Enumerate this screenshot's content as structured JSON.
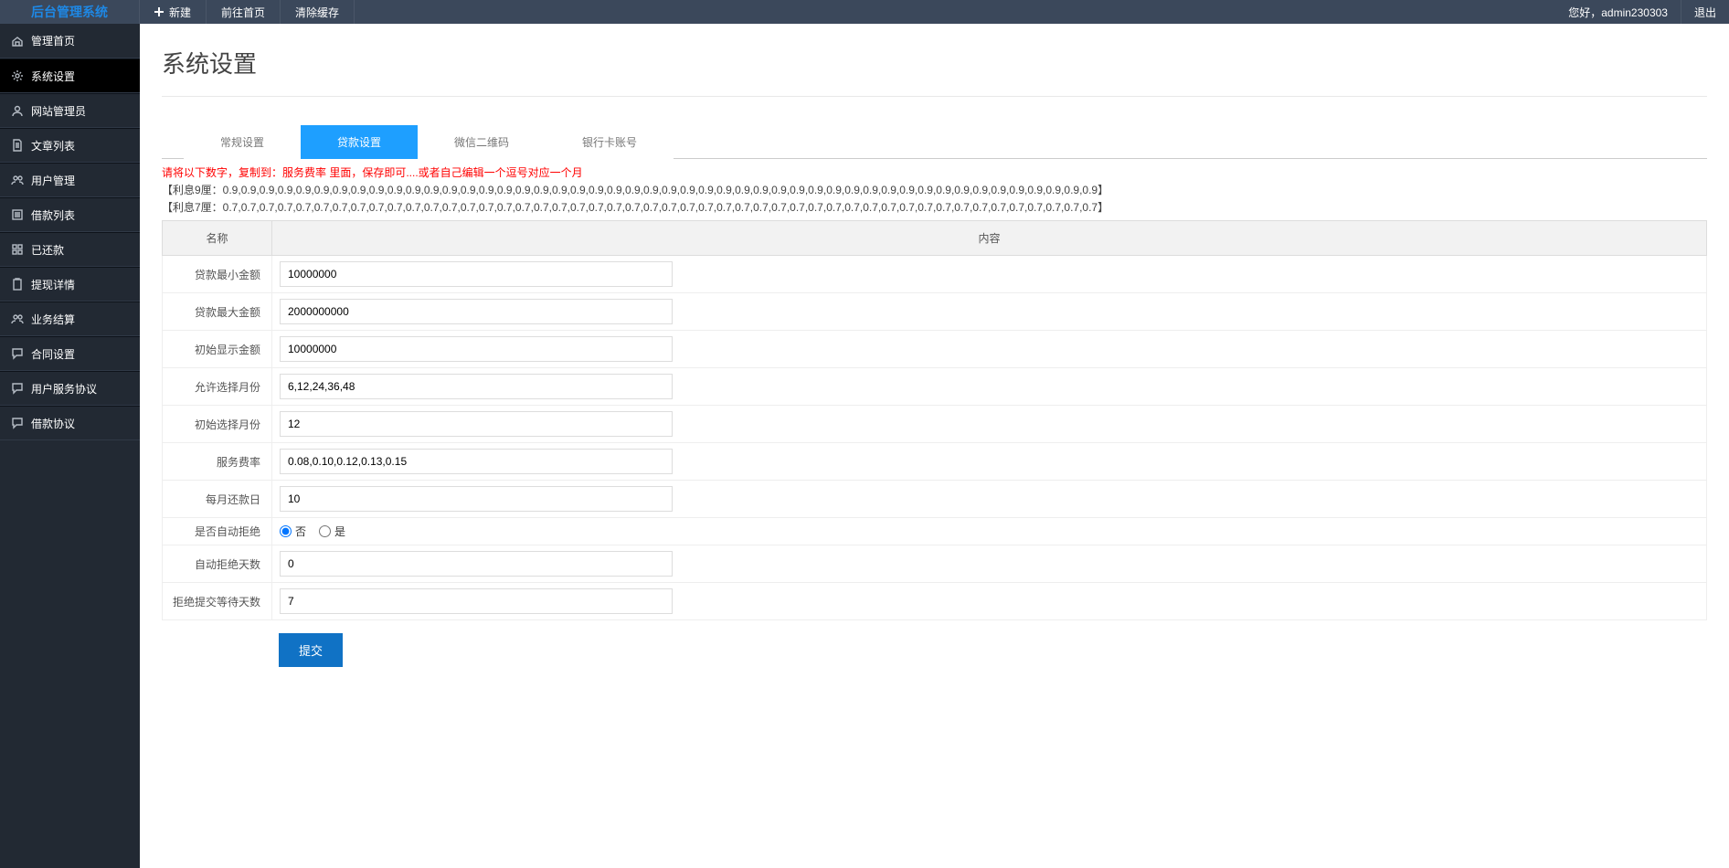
{
  "brand": "后台管理系统",
  "top": {
    "new": "新建",
    "home": "前往首页",
    "clear": "清除缓存",
    "welcome": "您好，admin230303",
    "logout": "退出"
  },
  "sidebar": [
    {
      "key": "dashboard",
      "label": "管理首页",
      "icon": "home"
    },
    {
      "key": "settings",
      "label": "系统设置",
      "icon": "gear",
      "active": true
    },
    {
      "key": "manager",
      "label": "网站管理员",
      "icon": "user"
    },
    {
      "key": "articles",
      "label": "文章列表",
      "icon": "doc"
    },
    {
      "key": "users",
      "label": "用户管理",
      "icon": "users"
    },
    {
      "key": "loans",
      "label": "借款列表",
      "icon": "list"
    },
    {
      "key": "repaid",
      "label": "已还款",
      "icon": "grid"
    },
    {
      "key": "withdraw",
      "label": "提现详情",
      "icon": "clip"
    },
    {
      "key": "biz",
      "label": "业务结算",
      "icon": "users"
    },
    {
      "key": "contract",
      "label": "合同设置",
      "icon": "chat"
    },
    {
      "key": "user-agree",
      "label": "用户服务协议",
      "icon": "chat"
    },
    {
      "key": "loan-agree",
      "label": "借款协议",
      "icon": "chat"
    }
  ],
  "page": {
    "title": "系统设置"
  },
  "tabs": [
    {
      "key": "general",
      "label": "常规设置"
    },
    {
      "key": "loan",
      "label": "贷款设置",
      "active": true
    },
    {
      "key": "wechat",
      "label": "微信二维码"
    },
    {
      "key": "bank",
      "label": "银行卡账号"
    }
  ],
  "warn_text": "请将以下数字，复制到：服务费率 里面，保存即可....或者自己编辑一个逗号对应一个月",
  "data_line1": "【利息9厘：0.9,0.9,0.9,0.9,0.9,0.9,0.9,0.9,0.9,0.9,0.9,0.9,0.9,0.9,0.9,0.9,0.9,0.9,0.9,0.9,0.9,0.9,0.9,0.9,0.9,0.9,0.9,0.9,0.9,0.9,0.9,0.9,0.9,0.9,0.9,0.9,0.9,0.9,0.9,0.9,0.9,0.9,0.9,0.9,0.9,0.9,0.9,0.9】",
  "data_line2": "【利息7厘：0.7,0.7,0.7,0.7,0.7,0.7,0.7,0.7,0.7,0.7,0.7,0.7,0.7,0.7,0.7,0.7,0.7,0.7,0.7,0.7,0.7,0.7,0.7,0.7,0.7,0.7,0.7,0.7,0.7,0.7,0.7,0.7,0.7,0.7,0.7,0.7,0.7,0.7,0.7,0.7,0.7,0.7,0.7,0.7,0.7,0.7,0.7,0.7】",
  "table": {
    "name_header": "名称",
    "content_header": "内容"
  },
  "fields": {
    "min_amount": {
      "label": "贷款最小金额",
      "value": "10000000"
    },
    "max_amount": {
      "label": "贷款最大金额",
      "value": "2000000000"
    },
    "init_amount": {
      "label": "初始显示金额",
      "value": "10000000"
    },
    "months_allow": {
      "label": "允许选择月份",
      "value": "6,12,24,36,48"
    },
    "months_init": {
      "label": "初始选择月份",
      "value": "12"
    },
    "service_rate": {
      "label": "服务费率",
      "value": "0.08,0.10,0.12,0.13,0.15"
    },
    "repay_day": {
      "label": "每月还款日",
      "value": "10"
    },
    "auto_reject": {
      "label": "是否自动拒绝",
      "value_no": "否",
      "value_yes": "是",
      "selected": "no"
    },
    "reject_days": {
      "label": "自动拒绝天数",
      "value": "0"
    },
    "wait_days": {
      "label": "拒绝提交等待天数",
      "value": "7"
    }
  },
  "submit_label": "提交"
}
